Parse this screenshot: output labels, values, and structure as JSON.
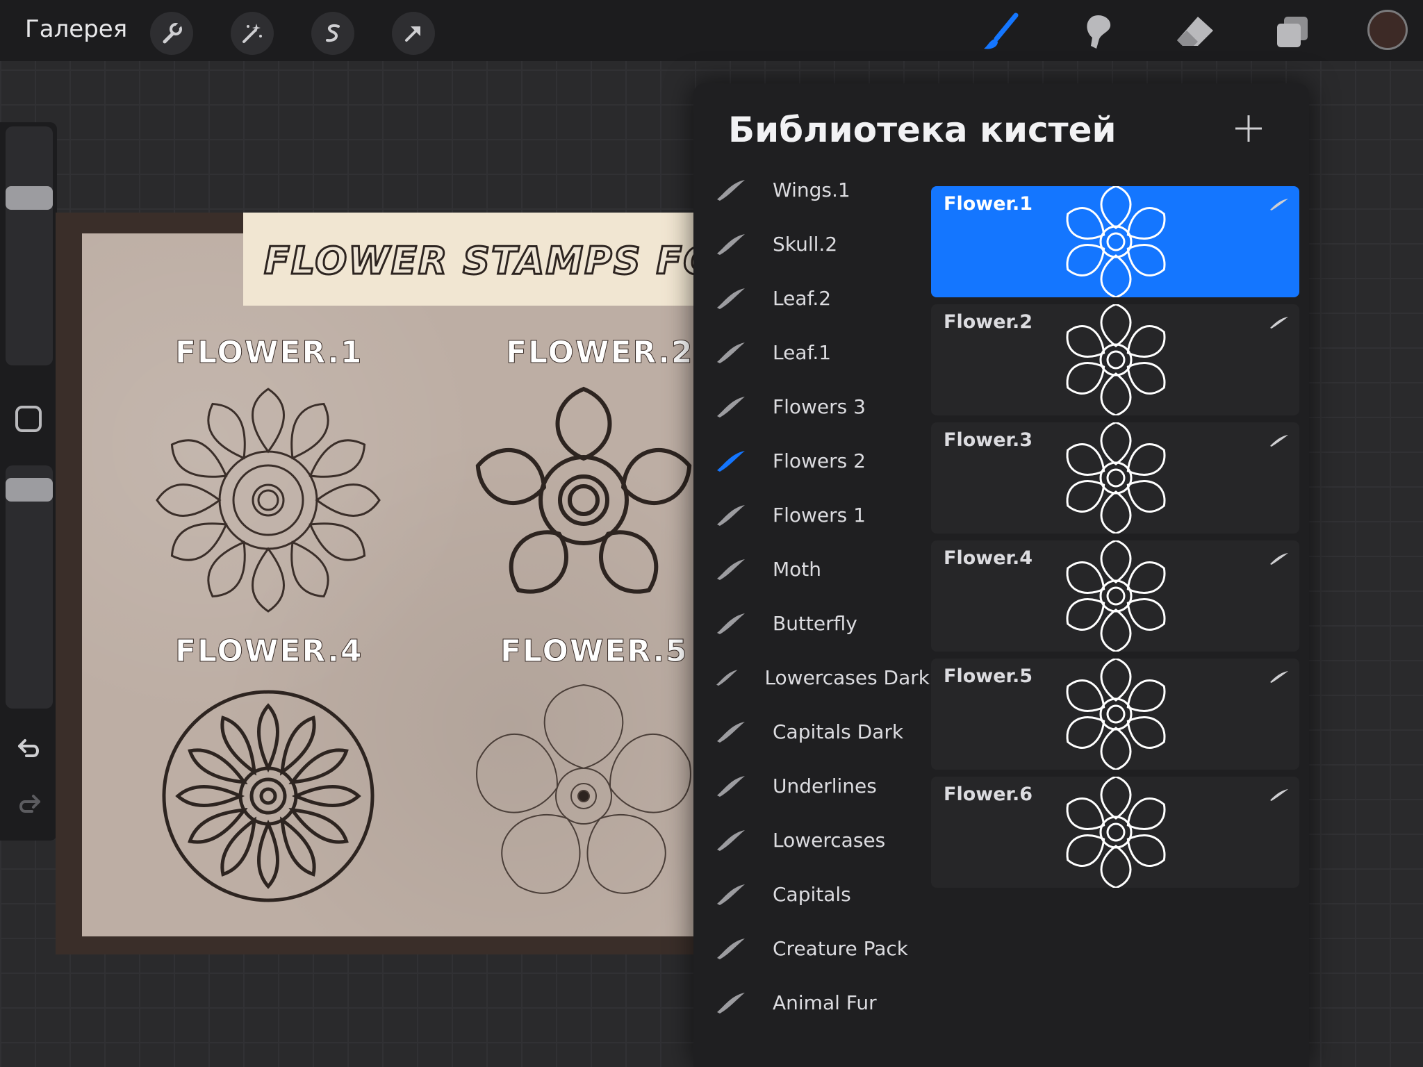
{
  "topbar": {
    "gallery_label": "Галерея",
    "left_tools": [
      {
        "icon": "wrench-icon"
      },
      {
        "icon": "magic-wand-icon"
      },
      {
        "icon": "selection-icon"
      },
      {
        "icon": "transform-arrow-icon"
      }
    ],
    "right_tools": [
      {
        "icon": "brush-icon",
        "active": true
      },
      {
        "icon": "smudge-icon"
      },
      {
        "icon": "eraser-icon"
      },
      {
        "icon": "layers-icon"
      }
    ],
    "current_color": "#3d2a26",
    "accent": "#1476ff"
  },
  "canvas": {
    "banner_text": "FLOWER STAMPS FOR P",
    "flower_labels": [
      "FLOWER.1",
      "FLOWER.2",
      "FLOWER.4",
      "FLOWER.5"
    ]
  },
  "panel": {
    "title": "Библиотека кистей",
    "brush_sets": [
      {
        "label": "Wings.1"
      },
      {
        "label": "Skull.2"
      },
      {
        "label": "Leaf.2"
      },
      {
        "label": "Leaf.1"
      },
      {
        "label": "Flowers 3"
      },
      {
        "label": "Flowers 2",
        "active": true
      },
      {
        "label": "Flowers 1"
      },
      {
        "label": "Moth"
      },
      {
        "label": "Butterfly"
      },
      {
        "label": "Lowercases Dark"
      },
      {
        "label": "Capitals Dark"
      },
      {
        "label": "Underlines"
      },
      {
        "label": "Lowercases"
      },
      {
        "label": "Capitals"
      },
      {
        "label": "Creature Pack"
      },
      {
        "label": "Animal Fur"
      }
    ],
    "brushes": [
      {
        "name": "Flower.1",
        "selected": true
      },
      {
        "name": "Flower.2"
      },
      {
        "name": "Flower.3"
      },
      {
        "name": "Flower.4"
      },
      {
        "name": "Flower.5"
      },
      {
        "name": "Flower.6"
      }
    ]
  }
}
